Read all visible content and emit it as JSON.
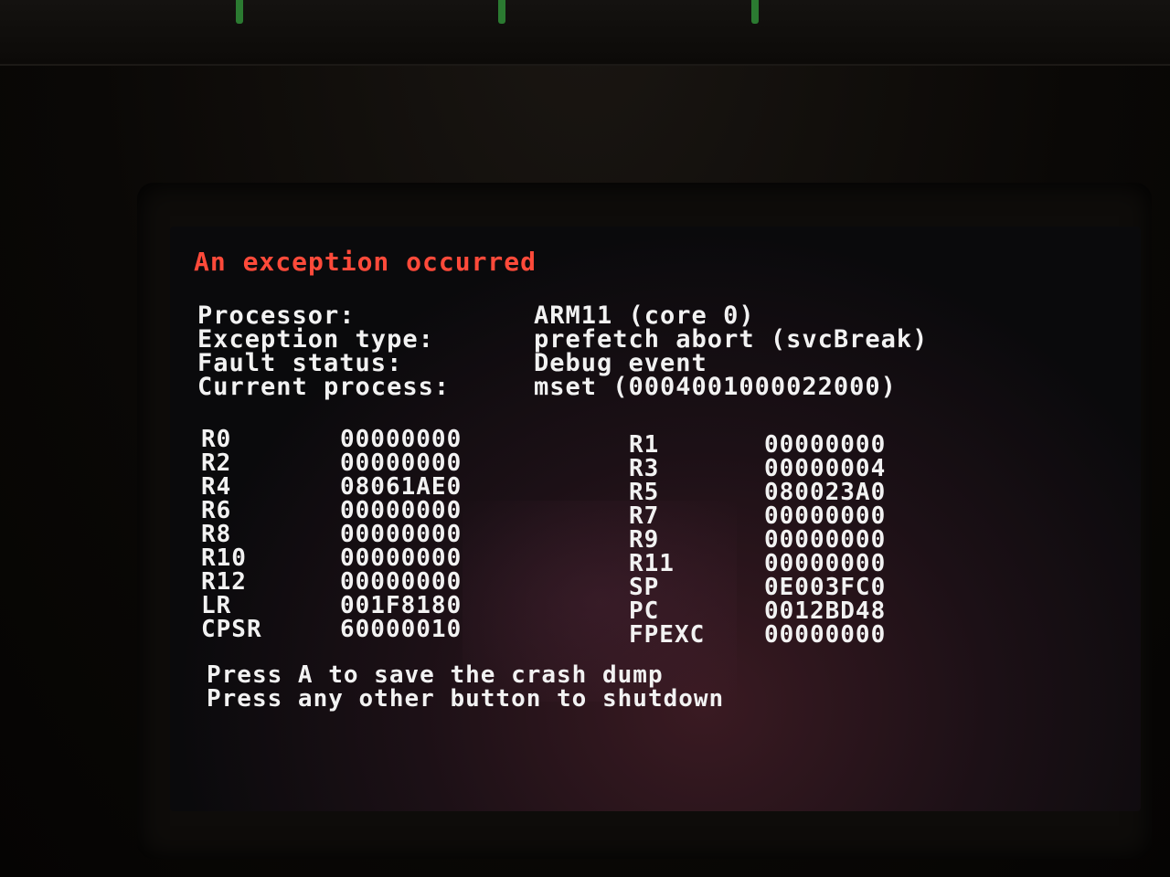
{
  "error_screen": {
    "title": "An exception occurred",
    "info": [
      {
        "label": "Processor:",
        "value": "ARM11 (core 0)"
      },
      {
        "label": "Exception type:",
        "value": "prefetch abort (svcBreak)"
      },
      {
        "label": "Fault status:",
        "value": "Debug event"
      },
      {
        "label": "Current process:",
        "value": "mset (0004001000022000)"
      }
    ],
    "registers_left": [
      {
        "name": "R0",
        "value": "00000000"
      },
      {
        "name": "R2",
        "value": "00000000"
      },
      {
        "name": "R4",
        "value": "08061AE0"
      },
      {
        "name": "R6",
        "value": "00000000"
      },
      {
        "name": "R8",
        "value": "00000000"
      },
      {
        "name": "R10",
        "value": "00000000"
      },
      {
        "name": "R12",
        "value": "00000000"
      },
      {
        "name": "LR",
        "value": "001F8180"
      },
      {
        "name": "CPSR",
        "value": "60000010"
      }
    ],
    "registers_right": [
      {
        "name": "R1",
        "value": "00000000"
      },
      {
        "name": "R3",
        "value": "00000004"
      },
      {
        "name": "R5",
        "value": "080023A0"
      },
      {
        "name": "R7",
        "value": "00000000"
      },
      {
        "name": "R9",
        "value": "00000000"
      },
      {
        "name": "R11",
        "value": "00000000"
      },
      {
        "name": "SP",
        "value": "0E003FC0"
      },
      {
        "name": "PC",
        "value": "0012BD48"
      },
      {
        "name": "FPEXC",
        "value": "00000000"
      }
    ],
    "prompts": [
      "Press A to save the crash dump",
      "Press any other button to shutdown"
    ]
  },
  "colors": {
    "title": "#ff4a3a",
    "text": "#f2f2f2",
    "background": "#0a0a0c"
  }
}
